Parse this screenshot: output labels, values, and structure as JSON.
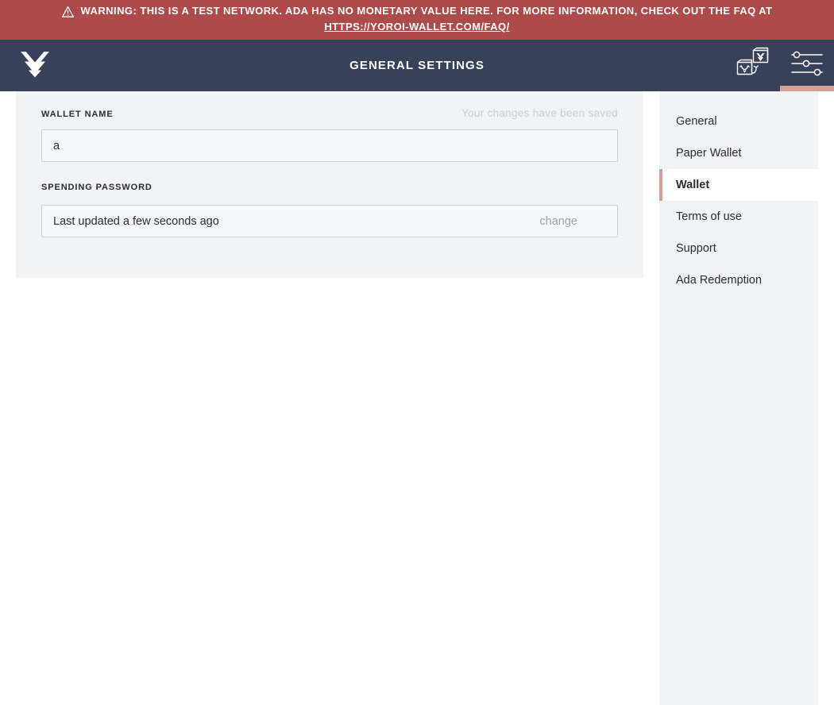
{
  "warning": {
    "icon": "warning-triangle-icon",
    "text": "WARNING: THIS IS A TEST NETWORK. ADA HAS NO MONETARY VALUE HERE. FOR MORE INFORMATION, CHECK OUT THE FAQ AT",
    "link_text": "HTTPS://YOROI-WALLET.COM/FAQ/",
    "background_color": "#ad4a4a",
    "text_color": "#ffffff"
  },
  "topbar": {
    "logo_icon": "yoroi-logo-icon",
    "title": "GENERAL SETTINGS",
    "background_color": "#38415a",
    "actions": [
      {
        "icon": "switch-wallet-icon",
        "active": false
      },
      {
        "icon": "settings-sliders-icon",
        "active": true
      }
    ],
    "active_indicator_color": "#d6a096"
  },
  "settings": {
    "wallet_name": {
      "label": "WALLET NAME",
      "value": "a",
      "placeholder": "Wallet name"
    },
    "save_status": "Your changes have been saved",
    "spending_password": {
      "label": "SPENDING PASSWORD",
      "status": "Last updated a few seconds ago",
      "change_label": "change"
    }
  },
  "menu": {
    "items": [
      {
        "label": "General",
        "active": false
      },
      {
        "label": "Paper Wallet",
        "active": false
      },
      {
        "label": "Wallet",
        "active": true
      },
      {
        "label": "Terms of use",
        "active": false
      },
      {
        "label": "Support",
        "active": false
      },
      {
        "label": "Ada Redemption",
        "active": false
      }
    ]
  }
}
